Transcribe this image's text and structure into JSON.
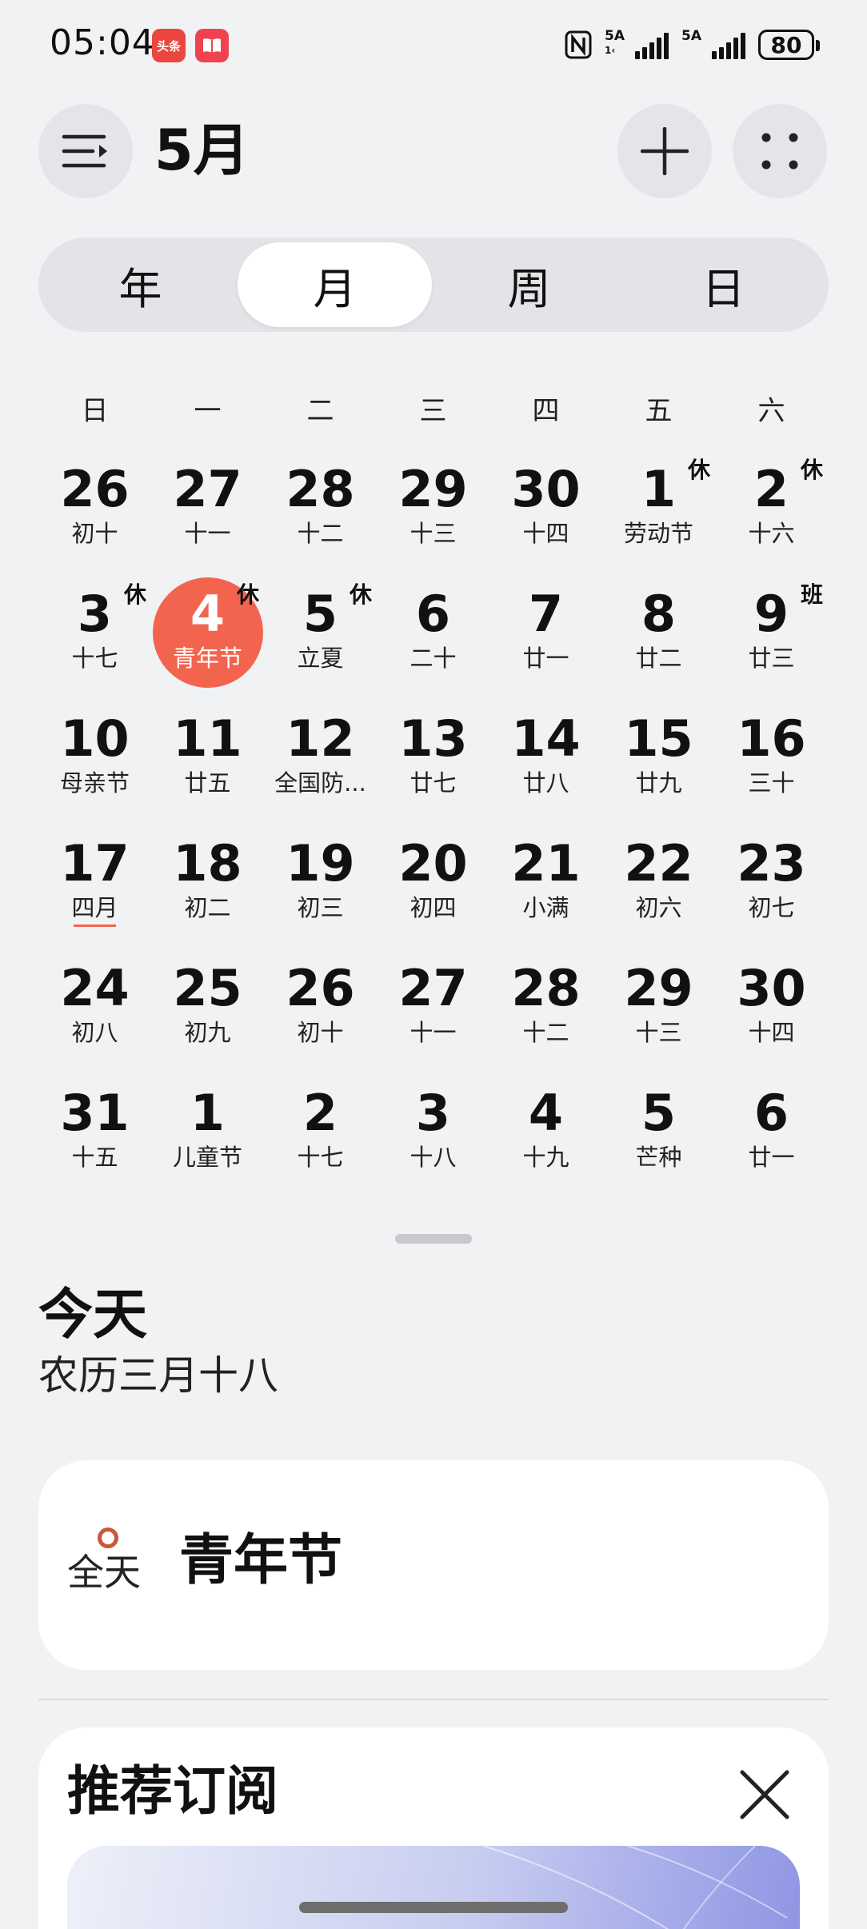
{
  "status": {
    "time": "05:04",
    "app_badges": [
      "头条",
      "📖"
    ],
    "signal1_label": "5A",
    "signal1_sub": "1‹",
    "signal2_label": "5A",
    "battery": "80"
  },
  "header": {
    "month_title": "5月"
  },
  "view_tabs": [
    {
      "label": "年",
      "active": false
    },
    {
      "label": "月",
      "active": true
    },
    {
      "label": "周",
      "active": false
    },
    {
      "label": "日",
      "active": false
    }
  ],
  "weekdays": [
    "日",
    "一",
    "二",
    "三",
    "四",
    "五",
    "六"
  ],
  "weeks": [
    [
      {
        "day": "26",
        "lunar": "初十",
        "tag": ""
      },
      {
        "day": "27",
        "lunar": "十一",
        "tag": ""
      },
      {
        "day": "28",
        "lunar": "十二",
        "tag": ""
      },
      {
        "day": "29",
        "lunar": "十三",
        "tag": ""
      },
      {
        "day": "30",
        "lunar": "十四",
        "tag": ""
      },
      {
        "day": "1",
        "lunar": "劳动节",
        "tag": "休"
      },
      {
        "day": "2",
        "lunar": "十六",
        "tag": "休"
      }
    ],
    [
      {
        "day": "3",
        "lunar": "十七",
        "tag": "休"
      },
      {
        "day": "4",
        "lunar": "青年节",
        "tag": "休",
        "today": true
      },
      {
        "day": "5",
        "lunar": "立夏",
        "tag": "休"
      },
      {
        "day": "6",
        "lunar": "二十",
        "tag": ""
      },
      {
        "day": "7",
        "lunar": "廿一",
        "tag": ""
      },
      {
        "day": "8",
        "lunar": "廿二",
        "tag": ""
      },
      {
        "day": "9",
        "lunar": "廿三",
        "tag": "班"
      }
    ],
    [
      {
        "day": "10",
        "lunar": "母亲节",
        "tag": ""
      },
      {
        "day": "11",
        "lunar": "廿五",
        "tag": ""
      },
      {
        "day": "12",
        "lunar": "全国防...",
        "tag": ""
      },
      {
        "day": "13",
        "lunar": "廿七",
        "tag": ""
      },
      {
        "day": "14",
        "lunar": "廿八",
        "tag": ""
      },
      {
        "day": "15",
        "lunar": "廿九",
        "tag": ""
      },
      {
        "day": "16",
        "lunar": "三十",
        "tag": ""
      }
    ],
    [
      {
        "day": "17",
        "lunar": "四月",
        "tag": "",
        "underline": true
      },
      {
        "day": "18",
        "lunar": "初二",
        "tag": ""
      },
      {
        "day": "19",
        "lunar": "初三",
        "tag": ""
      },
      {
        "day": "20",
        "lunar": "初四",
        "tag": ""
      },
      {
        "day": "21",
        "lunar": "小满",
        "tag": ""
      },
      {
        "day": "22",
        "lunar": "初六",
        "tag": ""
      },
      {
        "day": "23",
        "lunar": "初七",
        "tag": ""
      }
    ],
    [
      {
        "day": "24",
        "lunar": "初八",
        "tag": ""
      },
      {
        "day": "25",
        "lunar": "初九",
        "tag": ""
      },
      {
        "day": "26",
        "lunar": "初十",
        "tag": ""
      },
      {
        "day": "27",
        "lunar": "十一",
        "tag": ""
      },
      {
        "day": "28",
        "lunar": "十二",
        "tag": ""
      },
      {
        "day": "29",
        "lunar": "十三",
        "tag": ""
      },
      {
        "day": "30",
        "lunar": "十四",
        "tag": ""
      }
    ],
    [
      {
        "day": "31",
        "lunar": "十五",
        "tag": ""
      },
      {
        "day": "1",
        "lunar": "儿童节",
        "tag": ""
      },
      {
        "day": "2",
        "lunar": "十七",
        "tag": ""
      },
      {
        "day": "3",
        "lunar": "十八",
        "tag": ""
      },
      {
        "day": "4",
        "lunar": "十九",
        "tag": ""
      },
      {
        "day": "5",
        "lunar": "芒种",
        "tag": ""
      },
      {
        "day": "6",
        "lunar": "廿一",
        "tag": ""
      }
    ]
  ],
  "today": {
    "title": "今天",
    "lunar_date": "农历三月十八"
  },
  "event": {
    "all_day": "全天",
    "title": "青年节"
  },
  "subscription": {
    "title": "推荐订阅"
  },
  "colors": {
    "accent": "#f3644f",
    "background": "#f1f2f4"
  }
}
